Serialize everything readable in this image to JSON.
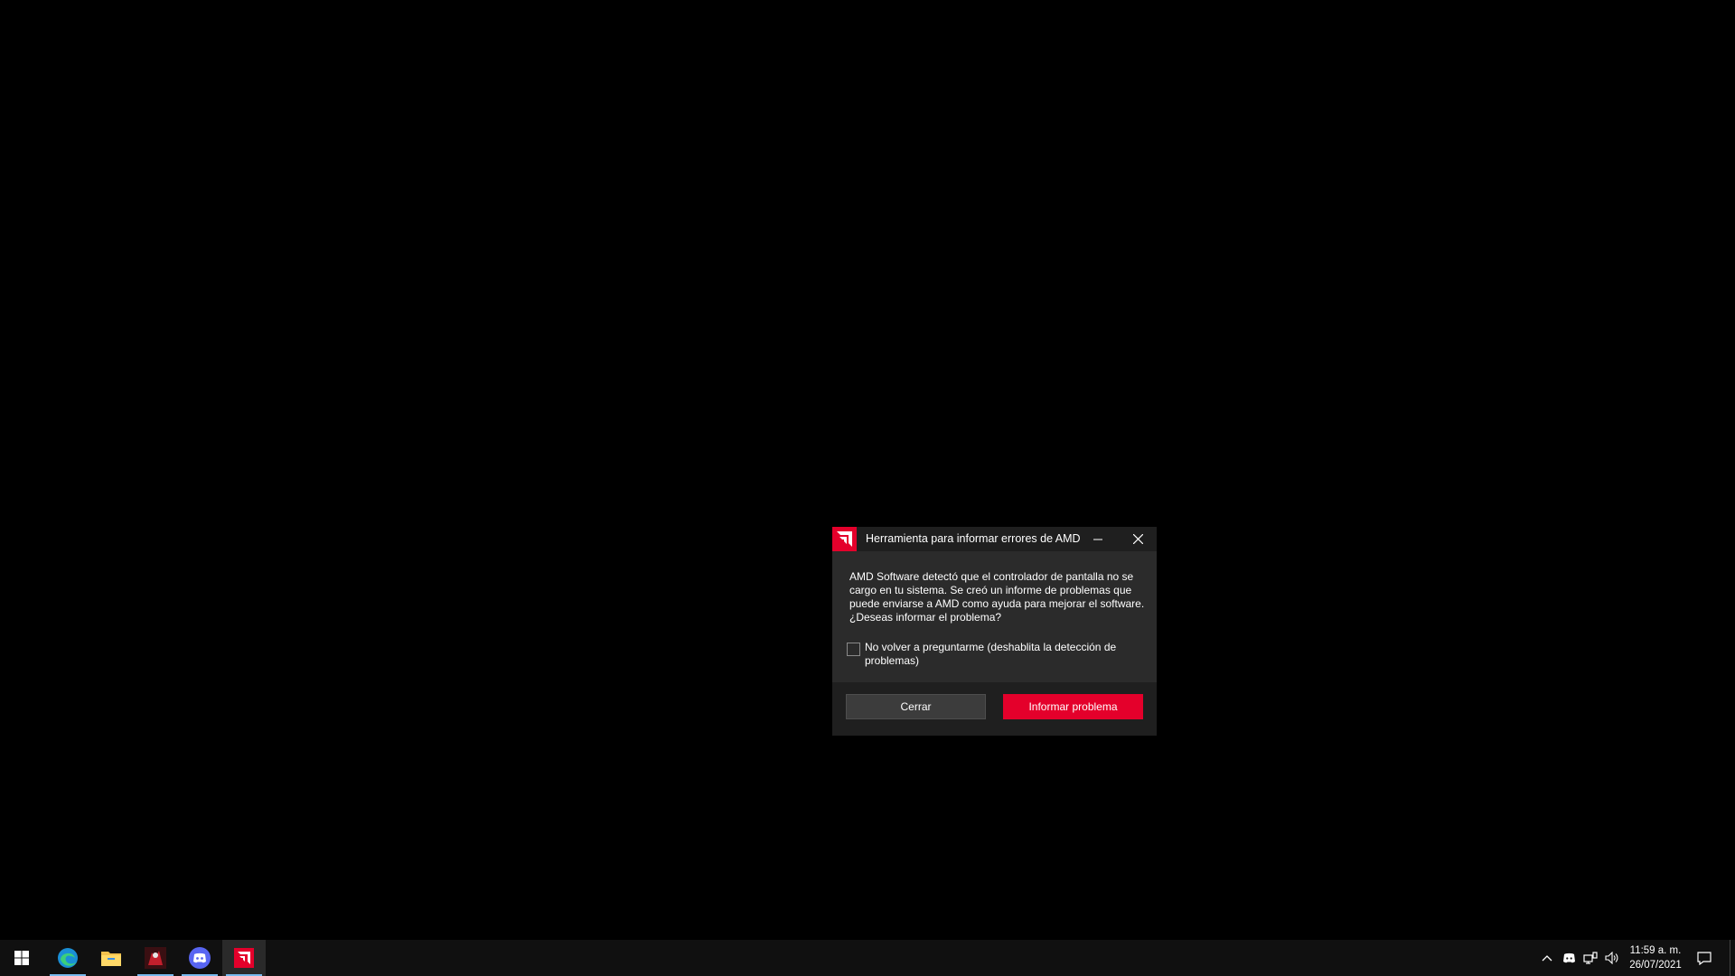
{
  "dialog": {
    "title": "Herramienta para informar errores de AMD",
    "message": "AMD Software detectó que el controlador de pantalla no se cargo en tu sistema. Se creó un informe de problemas que puede enviarse a AMD como ayuda para mejorar el software. ¿Deseas informar el problema?",
    "checkbox_label": "No volver a preguntarme (deshablita la detección de problemas)",
    "checkbox_checked": false,
    "close_button_label": "Cerrar",
    "report_button_label": "Informar problema",
    "accent_color": "#e4002b"
  },
  "taskbar": {
    "pinned": [
      {
        "name": "start-icon",
        "active": false
      },
      {
        "name": "edge-icon",
        "active": false,
        "running": true
      },
      {
        "name": "file-explorer-icon",
        "active": false,
        "running": false
      },
      {
        "name": "game-app-icon",
        "active": false,
        "running": true
      },
      {
        "name": "discord-icon",
        "active": false,
        "running": true
      },
      {
        "name": "amd-icon",
        "active": true,
        "running": true
      }
    ],
    "tray": [
      "chevron-up-icon",
      "discord-tray-icon",
      "network-icon",
      "volume-icon"
    ],
    "clock": {
      "time": "11:59 a. m.",
      "date": "26/07/2021"
    },
    "notification_icon": "action-center-icon"
  }
}
